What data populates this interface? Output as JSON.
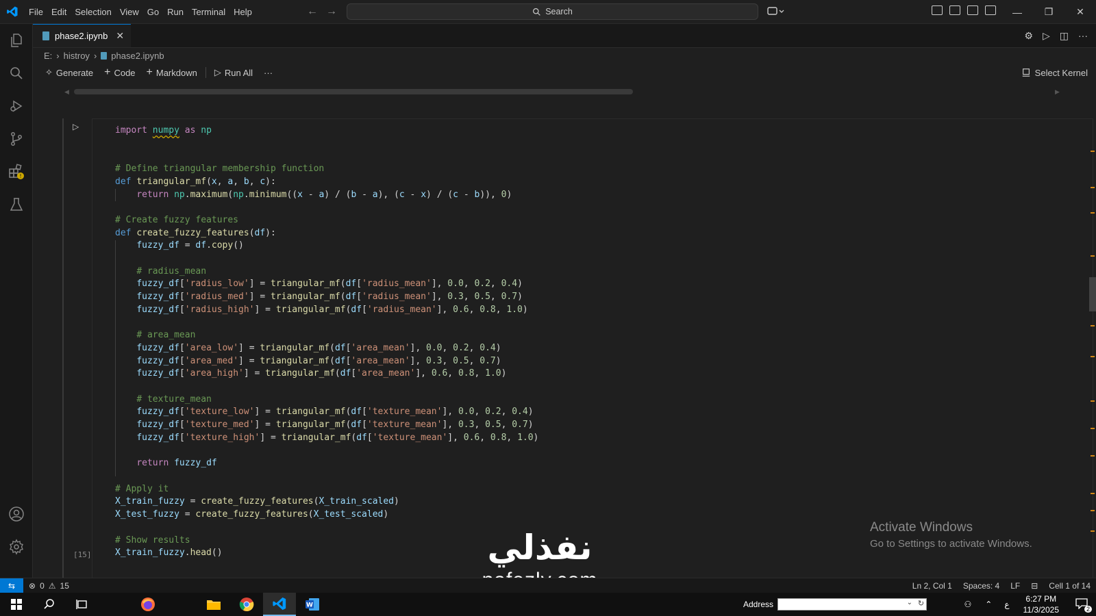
{
  "titlebar": {
    "menu": [
      "File",
      "Edit",
      "Selection",
      "View",
      "Go",
      "Run",
      "Terminal",
      "Help"
    ],
    "search_placeholder": "Search"
  },
  "tab": {
    "filename": "phase2.ipynb"
  },
  "breadcrumb": {
    "drive": "E:",
    "folder": "histroy",
    "file": "phase2.ipynb"
  },
  "notebook_toolbar": {
    "generate": "Generate",
    "code": "Code",
    "markdown": "Markdown",
    "run_all": "Run All",
    "select_kernel": "Select Kernel"
  },
  "cell": {
    "execution_count": "[15]",
    "code_lines": [
      "import numpy as np",
      "",
      "",
      "# Define triangular membership function",
      "def triangular_mf(x, a, b, c):",
      "    return np.maximum(np.minimum((x - a) / (b - a), (c - x) / (c - b)), 0)",
      "",
      "# Create fuzzy features",
      "def create_fuzzy_features(df):",
      "    fuzzy_df = df.copy()",
      "",
      "    # radius_mean",
      "    fuzzy_df['radius_low'] = triangular_mf(df['radius_mean'], 0.0, 0.2, 0.4)",
      "    fuzzy_df['radius_med'] = triangular_mf(df['radius_mean'], 0.3, 0.5, 0.7)",
      "    fuzzy_df['radius_high'] = triangular_mf(df['radius_mean'], 0.6, 0.8, 1.0)",
      "",
      "    # area_mean",
      "    fuzzy_df['area_low'] = triangular_mf(df['area_mean'], 0.0, 0.2, 0.4)",
      "    fuzzy_df['area_med'] = triangular_mf(df['area_mean'], 0.3, 0.5, 0.7)",
      "    fuzzy_df['area_high'] = triangular_mf(df['area_mean'], 0.6, 0.8, 1.0)",
      "",
      "    # texture_mean",
      "    fuzzy_df['texture_low'] = triangular_mf(df['texture_mean'], 0.0, 0.2, 0.4)",
      "    fuzzy_df['texture_med'] = triangular_mf(df['texture_mean'], 0.3, 0.5, 0.7)",
      "    fuzzy_df['texture_high'] = triangular_mf(df['texture_mean'], 0.6, 0.8, 1.0)",
      "",
      "    return fuzzy_df",
      "",
      "# Apply it",
      "X_train_fuzzy = create_fuzzy_features(X_train_scaled)",
      "X_test_fuzzy = create_fuzzy_features(X_test_scaled)",
      "",
      "# Show results",
      "X_train_fuzzy.head()"
    ]
  },
  "activate_windows": {
    "title": "Activate Windows",
    "subtitle": "Go to Settings to activate Windows."
  },
  "watermark": {
    "arabic": "نفذلي",
    "latin": "nafezly.com"
  },
  "statusbar": {
    "errors": "0",
    "warnings": "15",
    "position": "Ln 2, Col 1",
    "spaces": "Spaces: 4",
    "eol": "LF",
    "cell": "Cell 1 of 14"
  },
  "taskbar": {
    "address_label": "Address",
    "ime": "ع",
    "time": "6:27 PM",
    "date": "11/3/2025",
    "notifications": "2"
  },
  "colors": {
    "accent": "#0078d4",
    "editor_bg": "#1f1f1f",
    "keyword": "#569cd6",
    "function": "#dcdcaa",
    "comment": "#6a9955",
    "string": "#ce9178",
    "number": "#b5cea8"
  }
}
